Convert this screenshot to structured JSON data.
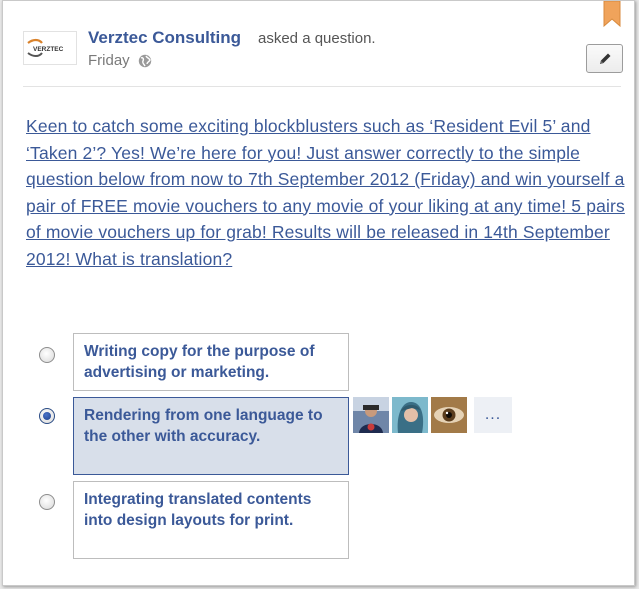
{
  "post": {
    "page_name": "Verztec Consulting",
    "action_text": "asked a question.",
    "timestamp": "Friday",
    "logo_text": "VERZTEC",
    "audience_icon": "globe-icon",
    "edit_icon": "pencil-icon",
    "bookmark_icon": "bookmark-icon"
  },
  "question": {
    "text": "Keen to catch some exciting blockblusters such as ‘Resident Evil 5’ and ‘Taken 2’? Yes! We’re here for you! Just answer correctly to the simple question below from now to 7th September 2012 (Friday) and win yourself a pair of FREE movie vouchers to any movie of your liking at any time! 5 pairs of movie vouchers up for grab! Results will be released in 14th September 2012! What is translation?"
  },
  "options": [
    {
      "label": "Writing copy for the purpose of advertising or marketing.",
      "selected": false
    },
    {
      "label": "Rendering from one language to the other with accuracy.",
      "selected": true
    },
    {
      "label": "Integrating translated contents into design layouts for print.",
      "selected": false
    }
  ],
  "voters": {
    "avatars": [
      "voter-avatar-1",
      "voter-avatar-2",
      "voter-avatar-3"
    ],
    "more_label": "..."
  },
  "colors": {
    "link": "#3b5998",
    "selected_bg": "#d8dfea",
    "bookmark": "#f0a35b"
  }
}
